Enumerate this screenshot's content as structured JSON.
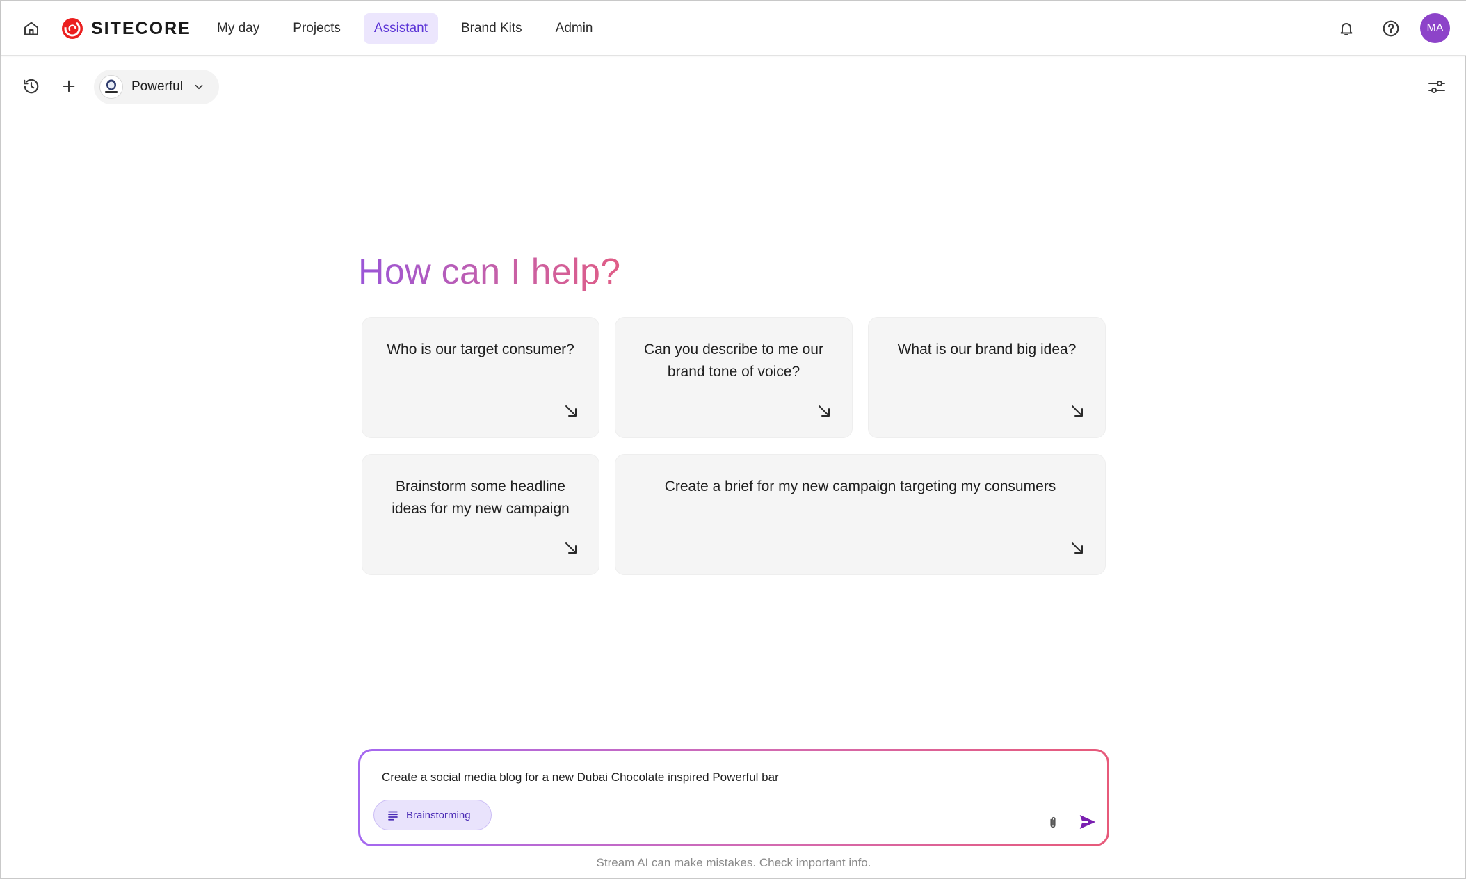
{
  "app": {
    "brand": "SITECORE",
    "accent_color": "#5b34d6",
    "active_tab_bg": "#ece6fd"
  },
  "topbar": {
    "nav": [
      {
        "label": "My day",
        "active": false
      },
      {
        "label": "Projects",
        "active": false
      },
      {
        "label": "Assistant",
        "active": true
      },
      {
        "label": "Brand Kits",
        "active": false
      },
      {
        "label": "Admin",
        "active": false
      }
    ],
    "avatar_initials": "MA",
    "avatar_color": "#8d43c9",
    "icons": [
      "home-icon",
      "bell-icon",
      "help-icon"
    ]
  },
  "toolbar": {
    "model_label": "Powerful",
    "icons": [
      "history-icon",
      "plus-icon",
      "chevron-down-icon",
      "settings-sliders-icon"
    ]
  },
  "main": {
    "headline": "How can I help?",
    "suggestions": [
      {
        "text": "Who is our target consumer?"
      },
      {
        "text": "Can you describe to me our brand tone of voice?"
      },
      {
        "text": "What is our brand big idea?"
      },
      {
        "text": "Brainstorm some headline ideas for my new campaign"
      },
      {
        "text": "Create a brief for my new campaign targeting my consumers"
      }
    ]
  },
  "composer": {
    "value": "Create a social media blog for a new Dubai Chocolate inspired Powerful bar",
    "mode_label": "Brainstorming",
    "send_color": "#7a1fb0"
  },
  "footer": {
    "disclaimer": "Stream AI can make mistakes. Check important info."
  }
}
